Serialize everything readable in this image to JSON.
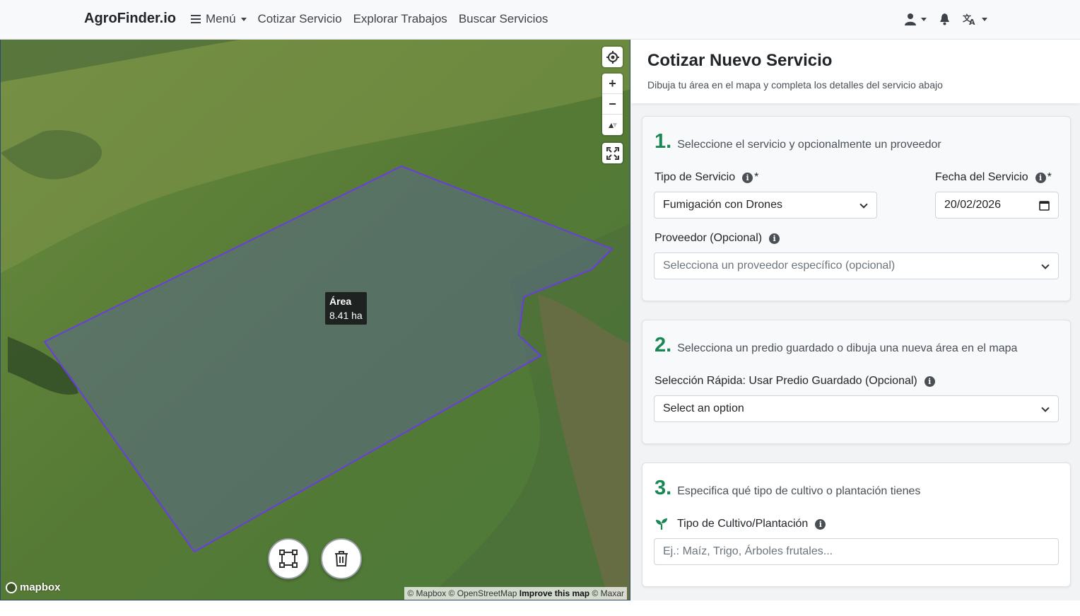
{
  "navbar": {
    "brand": "AgroFinder.io",
    "menu_label": "Menú",
    "links": [
      "Cotizar Servicio",
      "Explorar Trabajos",
      "Buscar Servicios"
    ],
    "icons": [
      "user-icon",
      "bell-icon",
      "translate-icon"
    ]
  },
  "map": {
    "area_title": "Área",
    "area_value": "8.41 ha",
    "zoom_in": "+",
    "zoom_out": "−",
    "logo": "mapbox",
    "attribution_1": "© Mapbox © OpenStreetMap",
    "attribution_improve": "Improve this map",
    "attribution_2": "© Maxar",
    "polygon_color": "#6a3dde"
  },
  "panel": {
    "title": "Cotizar Nuevo Servicio",
    "subtitle": "Dibuja tu área en el mapa y completa los detalles del servicio abajo",
    "step1": {
      "num": "1.",
      "text": "Seleccione el servicio y opcionalmente un proveedor",
      "service_label": "Tipo de Servicio",
      "service_value": "Fumigación con Drones",
      "date_label": "Fecha del Servicio",
      "date_value": "20/02/2026",
      "provider_label": "Proveedor (Opcional)",
      "provider_placeholder": "Selecciona un proveedor específico (opcional)",
      "required_mark": "*"
    },
    "step2": {
      "num": "2.",
      "text": "Selecciona un predio guardado o dibuja una nueva área en el mapa",
      "quick_label": "Selección Rápida: Usar Predio Guardado (Opcional)",
      "quick_placeholder": "Select an option"
    },
    "step3": {
      "num": "3.",
      "text": "Especifica qué tipo de cultivo o plantación tienes",
      "crop_label": "Tipo de Cultivo/Plantación",
      "crop_placeholder": "Ej.: Maíz, Trigo, Árboles frutales..."
    }
  },
  "colors": {
    "accent_green": "#198754",
    "navbar_bg": "#f8f9fa"
  }
}
